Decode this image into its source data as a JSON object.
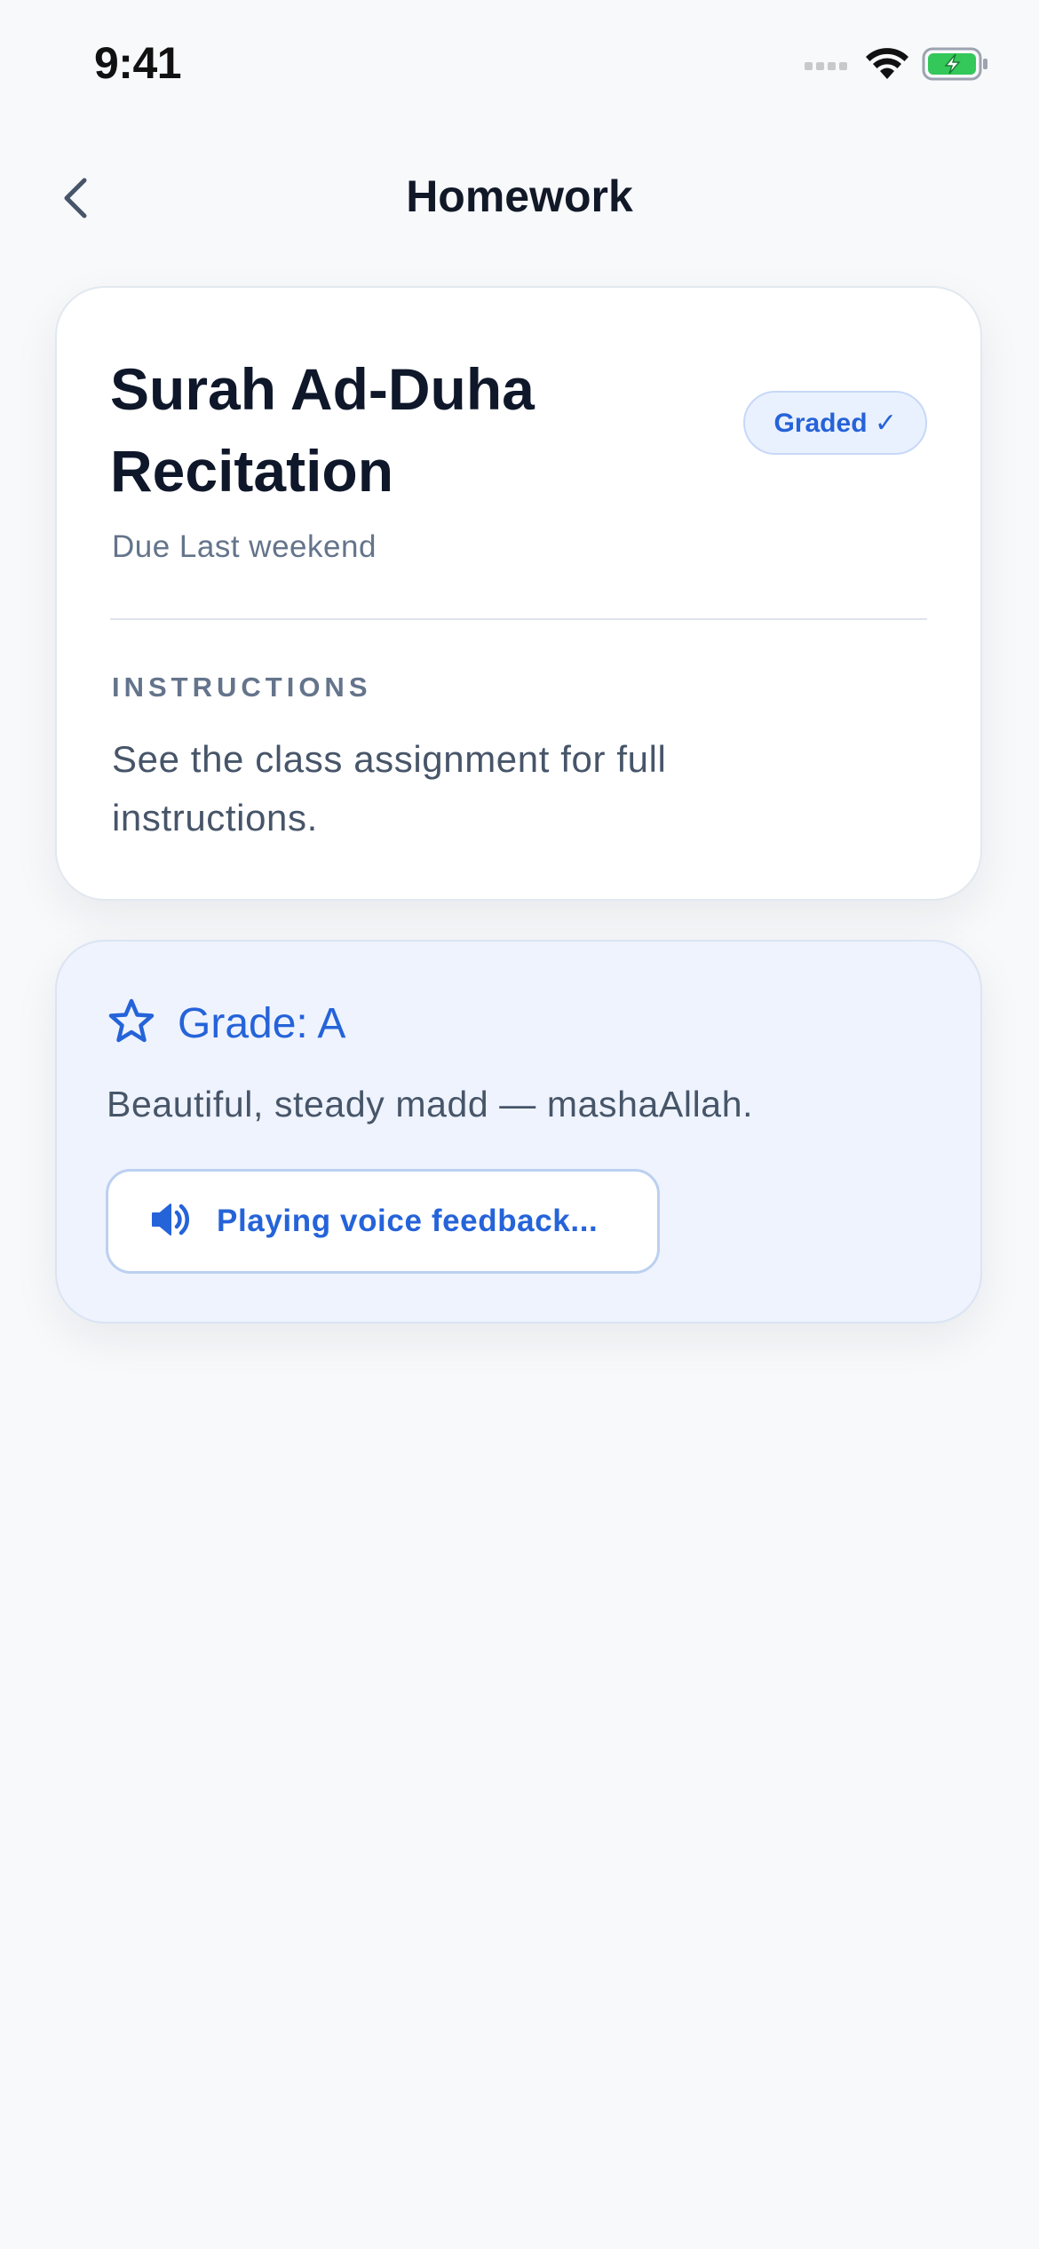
{
  "status_bar": {
    "time": "9:41"
  },
  "nav": {
    "title": "Homework",
    "back_icon": "chevron-left-icon"
  },
  "homework": {
    "title": "Surah Ad-Duha Recitation",
    "status_badge": "Graded ✓",
    "due": "Due Last weekend",
    "instructions_label": "INSTRUCTIONS",
    "instructions": "See the class assignment for full instructions."
  },
  "grade": {
    "icon": "star-icon",
    "label": "Grade: A",
    "feedback": "Beautiful, steady madd — mashaAllah.",
    "voice_button_label": "Playing voice feedback...",
    "voice_icon": "speaker-icon"
  },
  "colors": {
    "accent": "#2563d9",
    "background": "#f8f9fb",
    "grade_card_bg": "#eef3fd",
    "battery_green": "#34c759"
  }
}
